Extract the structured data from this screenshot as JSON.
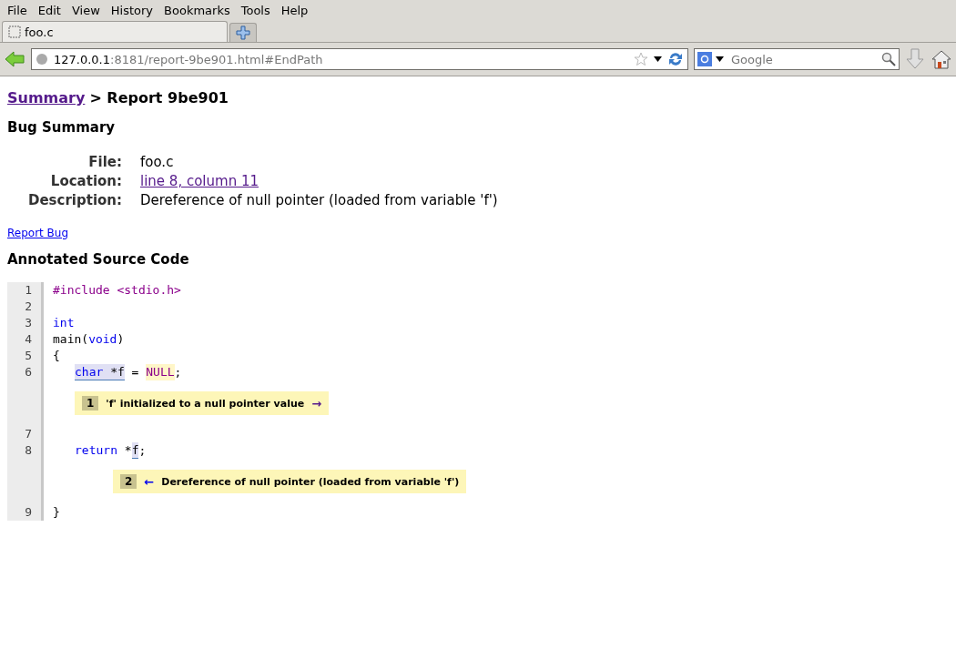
{
  "menu": [
    "File",
    "Edit",
    "View",
    "History",
    "Bookmarks",
    "Tools",
    "Help"
  ],
  "tabs": [
    {
      "label": "foo.c",
      "selected": true
    }
  ],
  "address": {
    "host": "127.0.0.1",
    "rest": ":8181/report-9be901.html#EndPath"
  },
  "search": {
    "placeholder": "Google"
  },
  "breadcrumb": {
    "link": "Summary",
    "current": "> Report 9be901"
  },
  "bug_summary": {
    "title": "Bug Summary",
    "rows": [
      {
        "label": "File:",
        "value": "foo.c",
        "kind": "text"
      },
      {
        "label": "Location:",
        "value": "line 8, column 11",
        "kind": "link"
      },
      {
        "label": "Description:",
        "value": "Dereference of null pointer (loaded from variable 'f')",
        "kind": "text"
      }
    ]
  },
  "report_link": "Report Bug",
  "source_title": "Annotated Source Code",
  "lines": [
    {
      "number": "1",
      "tokens": [
        {
          "text": "#include <stdio.h>",
          "kind": "directive"
        }
      ]
    },
    {
      "number": "2"
    },
    {
      "number": "3",
      "tokens": [
        {
          "text": "int",
          "kind": "keyword"
        }
      ]
    },
    {
      "number": "4",
      "tokens": [
        {
          "text": "main(",
          "kind": "plain"
        },
        {
          "text": "void",
          "kind": "keyword"
        },
        {
          "text": ")",
          "kind": "plain"
        }
      ]
    },
    {
      "number": "5",
      "tokens": [
        {
          "text": "{",
          "kind": "plain"
        }
      ]
    },
    {
      "number": "6",
      "kind": "nested",
      "tokens": [
        {
          "text": "char",
          "kind": "range-keyword"
        },
        {
          "text": " *f",
          "kind": "range"
        },
        {
          "text": " = ",
          "kind": "plain"
        },
        {
          "text": "NULL",
          "kind": "null"
        },
        {
          "text": ";",
          "kind": "plain"
        }
      ],
      "note": {
        "number": "1",
        "text": "'f' initialized to a null pointer value",
        "trail": "→"
      }
    },
    {
      "number": "7"
    },
    {
      "number": "8",
      "kind": "nested",
      "tokens": [
        {
          "text": "return",
          "kind": "keyword"
        },
        {
          "text": " *",
          "kind": "plain"
        },
        {
          "text": "f",
          "kind": "range"
        },
        {
          "text": ";",
          "kind": "plain"
        }
      ],
      "note": {
        "number": "2",
        "text": "Dereference of null pointer (loaded from variable 'f')",
        "lead": "←"
      }
    },
    {
      "number": "9",
      "tokens": [
        {
          "text": "}",
          "kind": "plain"
        }
      ]
    }
  ]
}
